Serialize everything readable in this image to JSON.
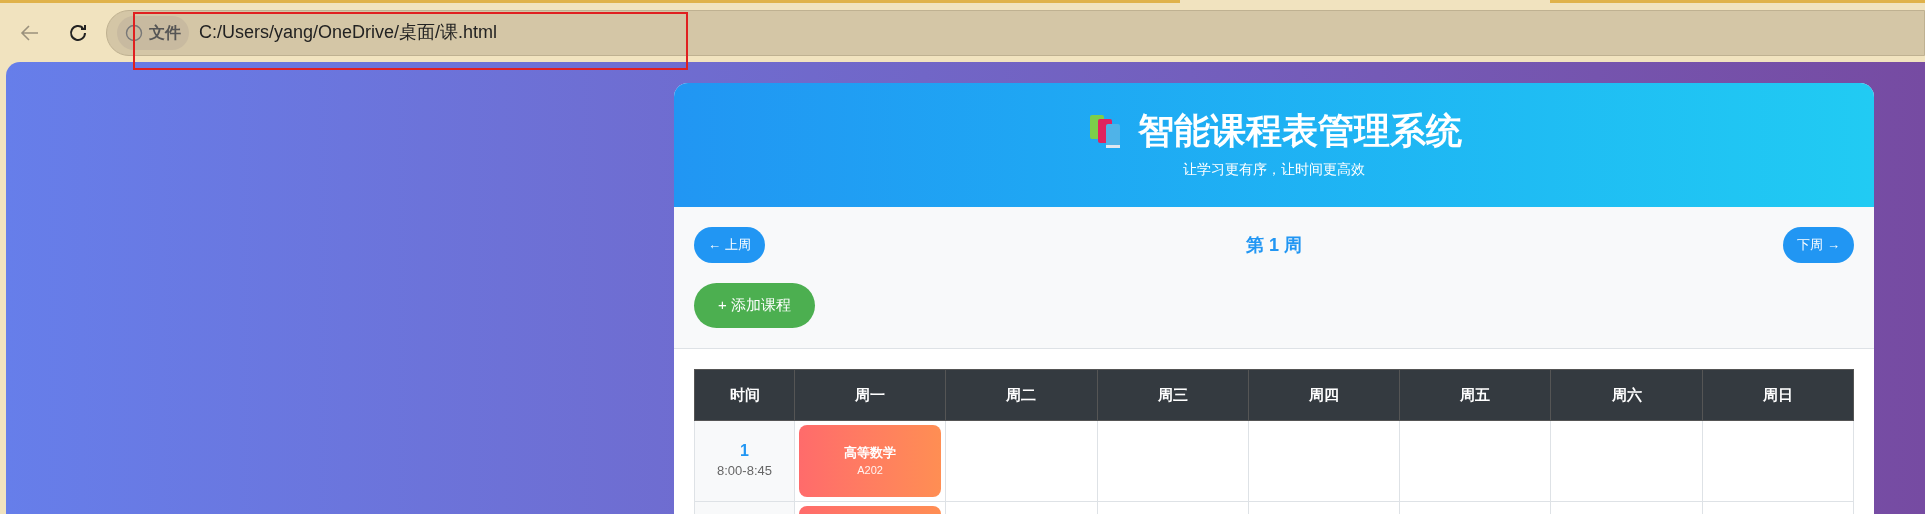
{
  "browser": {
    "back_disabled": true,
    "site_chip": "文件",
    "url": "C:/Users/yang/OneDrive/桌面/课.html",
    "highlight": true
  },
  "header": {
    "title": "智能课程表管理系统",
    "subtitle": "让学习更有序，让时间更高效"
  },
  "controls": {
    "prev": "← 上周",
    "week": "第 1 周",
    "next": "下周 →",
    "add": "+ 添加课程"
  },
  "table": {
    "columns": [
      "时间",
      "周一",
      "周二",
      "周三",
      "周四",
      "周五",
      "周六",
      "周日"
    ],
    "rows": [
      {
        "cells": [
          {
            "kind": "time",
            "period": "1",
            "time": "8:00-8:45"
          },
          {
            "kind": "course",
            "name": "高等数学",
            "room": "A202"
          },
          {
            "kind": "empty"
          },
          {
            "kind": "empty"
          },
          {
            "kind": "empty"
          },
          {
            "kind": "empty"
          },
          {
            "kind": "empty"
          },
          {
            "kind": "empty"
          }
        ]
      },
      {
        "cells": [
          {
            "kind": "time"
          },
          {
            "kind": "course"
          },
          {
            "kind": "empty"
          },
          {
            "kind": "empty"
          },
          {
            "kind": "empty"
          },
          {
            "kind": "empty"
          },
          {
            "kind": "empty"
          },
          {
            "kind": "empty"
          }
        ]
      }
    ]
  }
}
